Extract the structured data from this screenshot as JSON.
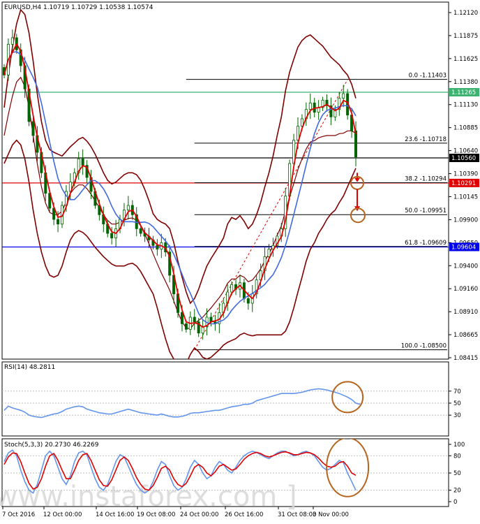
{
  "chart_data": [
    {
      "type": "candlestick",
      "title": "EURUSD,H4  1.10719 1.10729 1.10538 1.10574",
      "ylim": [
        1.08415,
        1.1212
      ],
      "y_ticks": [
        "1.12120",
        "1.11875",
        "1.11625",
        "1.11380",
        "1.11130",
        "1.10885",
        "1.10640",
        "1.10390",
        "1.10145",
        "1.09900",
        "1.09650",
        "1.09400",
        "1.09160",
        "1.08910",
        "1.08665",
        "1.08415"
      ],
      "x_ticks": [
        "7 Oct 2016",
        "12 Oct 00:00",
        "14 Oct 16:00",
        "19 Oct 08:00",
        "24 Oct 00:00",
        "26 Oct 16:00",
        "31 Oct 08:00",
        "3 Nov 00:00"
      ],
      "close": [
        1.1145,
        1.1178,
        1.1185,
        1.1172,
        1.1155,
        1.113,
        1.1095,
        1.108,
        1.1062,
        1.104,
        1.1018,
        1.1002,
        1.099,
        1.0985,
        1.1005,
        1.102,
        1.103,
        1.104,
        1.1055,
        1.1048,
        1.1035,
        1.102,
        1.1005,
        1.0995,
        1.0985,
        1.0975,
        1.097,
        1.098,
        1.099,
        1.1,
        1.1005,
        1.0995,
        1.098,
        1.0975,
        1.0972,
        1.0968,
        1.0962,
        1.0958,
        1.0965,
        1.0955,
        1.093,
        1.091,
        1.089,
        1.0878,
        1.0872,
        1.0885,
        1.088,
        1.0868,
        1.0875,
        1.0885,
        1.088,
        1.0878,
        1.089,
        1.09,
        1.0912,
        1.092,
        1.0915,
        1.0922,
        1.0905,
        1.09,
        1.091,
        1.0925,
        1.0935,
        1.095,
        1.0958,
        1.0962,
        1.0972,
        1.098,
        1.1015,
        1.105,
        1.1075,
        1.109,
        1.1098,
        1.1108,
        1.1115,
        1.1105,
        1.111,
        1.1118,
        1.1112,
        1.11,
        1.1108,
        1.112,
        1.1125,
        1.1102,
        1.1085,
        1.1057
      ],
      "bollinger": {
        "upper": [
          1.111,
          1.1145,
          1.1175,
          1.12,
          1.1215,
          1.121,
          1.119,
          1.116,
          1.1125,
          1.1095,
          1.1075,
          1.1065,
          1.1062,
          1.106,
          1.1058,
          1.1063,
          1.1068,
          1.1072,
          1.1076,
          1.1078,
          1.1074,
          1.1068,
          1.106,
          1.105,
          1.104,
          1.1032,
          1.1028,
          1.103,
          1.1034,
          1.1038,
          1.104,
          1.104,
          1.1038,
          1.1032,
          1.1022,
          1.101,
          1.0996,
          1.099,
          1.0987,
          1.0985,
          1.098,
          1.0965,
          1.0945,
          1.0928,
          1.0912,
          1.09,
          1.0905,
          1.0915,
          1.0928,
          1.094,
          1.0948,
          1.0955,
          1.0962,
          1.097,
          1.0985,
          1.0992,
          1.099,
          1.0994,
          1.0988,
          1.098,
          1.0985,
          1.0995,
          1.1008,
          1.1025,
          1.104,
          1.1058,
          1.108,
          1.11,
          1.1128,
          1.1148,
          1.1162,
          1.1175,
          1.1182,
          1.1186,
          1.1188,
          1.1184,
          1.118,
          1.1176,
          1.117,
          1.1164,
          1.116,
          1.1156,
          1.115,
          1.1145,
          1.1135,
          1.112
        ],
        "lower": [
          1.105,
          1.106,
          1.107,
          1.1075,
          1.107,
          1.1055,
          1.103,
          1.1,
          1.0975,
          1.0955,
          1.094,
          1.093,
          1.0928,
          1.093,
          1.094,
          1.0955,
          1.0968,
          1.0975,
          1.0978,
          1.0976,
          1.0972,
          1.0966,
          1.096,
          1.0955,
          1.095,
          1.0946,
          1.0942,
          1.094,
          1.094,
          1.094,
          1.0942,
          1.0943,
          1.094,
          1.0934,
          1.0926,
          1.0918,
          1.091,
          1.0895,
          1.0878,
          1.0862,
          1.0848,
          1.084,
          1.0835,
          1.0832,
          1.0835,
          1.0845,
          1.0852,
          1.0848,
          1.0842,
          1.084,
          1.0842,
          1.0846,
          1.085,
          1.0855,
          1.0858,
          1.086,
          1.0862,
          1.0866,
          1.0868,
          1.0866,
          1.0865,
          1.0866,
          1.0866,
          1.0866,
          1.0866,
          1.0866,
          1.0866,
          1.0866,
          1.087,
          1.088,
          1.0895,
          1.0912,
          1.0928,
          1.0945,
          1.0958,
          1.0965,
          1.0975,
          1.0982,
          1.099,
          1.0996,
          1.1,
          1.1008,
          1.1015,
          1.1025,
          1.1035,
          1.1045
        ]
      },
      "price_labels": [
        {
          "text": "1.11265",
          "value": 1.11265,
          "color": "#3cb371"
        },
        {
          "text": "1.10560",
          "value": 1.1056,
          "color": "#000000"
        },
        {
          "text": "1.10291",
          "value": 1.10291,
          "color": "#e00000"
        },
        {
          "text": "1.09604",
          "value": 1.09604,
          "color": "#0000ee"
        }
      ],
      "horizontal_lines": [
        {
          "value": 1.11265,
          "color": "#3cb371"
        },
        {
          "value": 1.1056,
          "color": "#000000"
        },
        {
          "value": 1.10291,
          "color": "#e00000"
        },
        {
          "value": 1.09604,
          "color": "#0000ee"
        }
      ],
      "fibonacci": [
        {
          "label": "0.0 -1.11403",
          "value": 1.11403
        },
        {
          "label": "23.6 -1.10718",
          "value": 1.10718
        },
        {
          "label": "38.2 -1.10294",
          "value": 1.10294
        },
        {
          "label": "50.0 -1.09951",
          "value": 1.09951
        },
        {
          "label": "61.8 -1.09609",
          "value": 1.09609
        },
        {
          "label": "100.0 -1.08500",
          "value": 1.085
        }
      ]
    },
    {
      "type": "line",
      "title": "RSI(14) 48.2811",
      "ylim": [
        0,
        100
      ],
      "y_ticks": [
        "70",
        "50",
        "30"
      ],
      "values": [
        38,
        45,
        42,
        40,
        38,
        35,
        30,
        28,
        27,
        26,
        28,
        30,
        32,
        33,
        36,
        40,
        42,
        44,
        45,
        44,
        40,
        38,
        36,
        34,
        33,
        32,
        32,
        34,
        36,
        38,
        40,
        38,
        36,
        34,
        33,
        32,
        31,
        30,
        32,
        30,
        28,
        27,
        27,
        28,
        30,
        33,
        34,
        34,
        35,
        36,
        37,
        38,
        38,
        40,
        42,
        44,
        45,
        46,
        48,
        48,
        50,
        54,
        56,
        58,
        60,
        62,
        64,
        66,
        66,
        66,
        66,
        67,
        68,
        70,
        72,
        73,
        74,
        73,
        72,
        70,
        68,
        66,
        63,
        60,
        56,
        50,
        48
      ]
    },
    {
      "type": "line",
      "title": "Stoch(5,3,3) 20.2730 46.2269",
      "ylim": [
        0,
        100
      ],
      "y_ticks": [
        "100",
        "80",
        "50",
        "20",
        "0"
      ],
      "series": [
        {
          "values": [
            70,
            85,
            90,
            80,
            55,
            35,
            20,
            15,
            30,
            55,
            80,
            88,
            80,
            60,
            40,
            30,
            45,
            70,
            85,
            88,
            82,
            60,
            40,
            25,
            20,
            30,
            50,
            70,
            82,
            78,
            62,
            45,
            30,
            20,
            15,
            20,
            35,
            55,
            70,
            65,
            45,
            28,
            20,
            25,
            40,
            60,
            72,
            65,
            50,
            40,
            45,
            60,
            70,
            65,
            55,
            50,
            60,
            72,
            80,
            85,
            88,
            86,
            82,
            78,
            75,
            80,
            85,
            88,
            88,
            84,
            80,
            82,
            86,
            88,
            85,
            80,
            70,
            60,
            55,
            58,
            65,
            72,
            68,
            50,
            35,
            20
          ]
        },
        {
          "values": [
            65,
            78,
            85,
            84,
            70,
            50,
            32,
            22,
            25,
            40,
            62,
            80,
            84,
            72,
            55,
            40,
            40,
            55,
            72,
            82,
            84,
            72,
            55,
            38,
            28,
            27,
            38,
            55,
            72,
            78,
            72,
            58,
            42,
            30,
            22,
            20,
            28,
            42,
            58,
            62,
            55,
            40,
            30,
            26,
            32,
            45,
            60,
            65,
            60,
            50,
            45,
            52,
            62,
            65,
            60,
            55,
            57,
            65,
            74,
            80,
            84,
            86,
            84,
            80,
            78,
            80,
            83,
            86,
            87,
            85,
            82,
            82,
            84,
            86,
            85,
            82,
            76,
            68,
            62,
            60,
            62,
            68,
            70,
            62,
            50,
            46
          ]
        }
      ]
    }
  ],
  "watermark": "[ www.instaforex.com ]",
  "colors": {
    "candle": "#006400",
    "bollinger": "#800000",
    "ma_blue": "#4169e1",
    "ma_red": "#e00000",
    "rsi": "#6495ed",
    "stoch_main": "#6495ed",
    "stoch_signal": "#e00000",
    "annotation_circle": "#b5651d",
    "arrow": "#e00000"
  }
}
